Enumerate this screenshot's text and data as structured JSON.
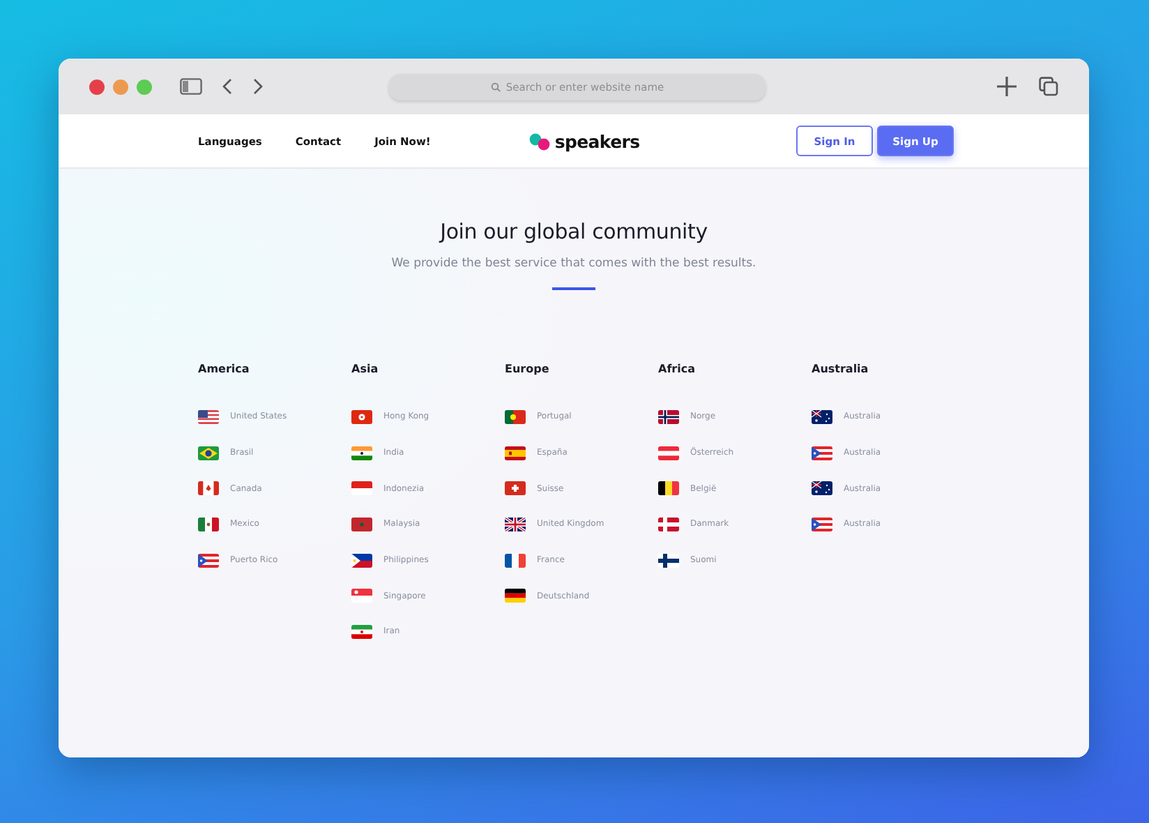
{
  "browser": {
    "address_placeholder": "Search or enter website name"
  },
  "nav": {
    "links": [
      "Languages",
      "Contact",
      "Join Now!"
    ],
    "logo": "speakers",
    "sign_in": "Sign In",
    "sign_up": "Sign Up"
  },
  "hero": {
    "title": "Join our global community",
    "subtitle": "We provide the best service that comes with the best results."
  },
  "regions": [
    {
      "name": "America",
      "countries": [
        {
          "name": "United States",
          "kind": "us"
        },
        {
          "name": "Brasil",
          "kind": "br"
        },
        {
          "name": "Canada",
          "kind": "ca"
        },
        {
          "name": "Mexico",
          "kind": "mx"
        },
        {
          "name": "Puerto Rico",
          "kind": "pr"
        }
      ]
    },
    {
      "name": "Asia",
      "countries": [
        {
          "name": "Hong Kong",
          "kind": "hk"
        },
        {
          "name": "India",
          "kind": "in"
        },
        {
          "name": "Indonezia",
          "kind": "id"
        },
        {
          "name": "Malaysia",
          "kind": "ma"
        },
        {
          "name": "Philippines",
          "kind": "ph"
        },
        {
          "name": "Singapore",
          "kind": "sg"
        },
        {
          "name": "Iran",
          "kind": "ir"
        }
      ]
    },
    {
      "name": "Europe",
      "countries": [
        {
          "name": "Portugal",
          "kind": "pt"
        },
        {
          "name": "España",
          "kind": "es"
        },
        {
          "name": "Suisse",
          "kind": "ch"
        },
        {
          "name": "United Kingdom",
          "kind": "gb"
        },
        {
          "name": "France",
          "kind": "fr"
        },
        {
          "name": "Deutschland",
          "kind": "de"
        }
      ]
    },
    {
      "name": "Africa",
      "countries": [
        {
          "name": "Norge",
          "kind": "no"
        },
        {
          "name": "Österreich",
          "kind": "at"
        },
        {
          "name": "België",
          "kind": "be"
        },
        {
          "name": "Danmark",
          "kind": "dk"
        },
        {
          "name": "Suomi",
          "kind": "fi"
        }
      ]
    },
    {
      "name": "Australia",
      "countries": [
        {
          "name": "Australia",
          "kind": "au"
        },
        {
          "name": "Australia",
          "kind": "pr"
        },
        {
          "name": "Australia",
          "kind": "au"
        },
        {
          "name": "Australia",
          "kind": "pr"
        }
      ]
    }
  ]
}
